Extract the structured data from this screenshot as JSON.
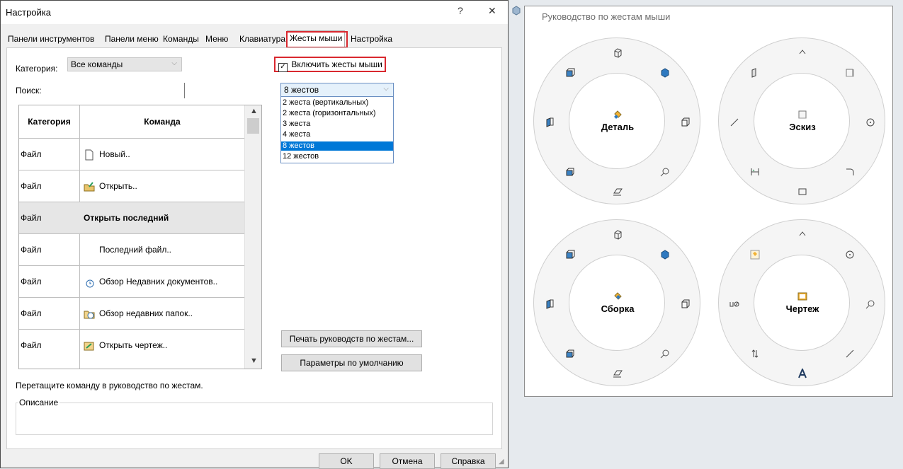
{
  "dialog": {
    "title": "Настройка",
    "help_button": "?",
    "close_button": "✕",
    "tabs": [
      "Панели инструментов",
      "Панели меню",
      "Команды",
      "Меню",
      "Клавиатура",
      "Жесты мыши",
      "Настройка"
    ],
    "active_tab": "Жесты мыши",
    "category_label": "Категория:",
    "category_value": "Все команды",
    "search_label": "Поиск:",
    "search_value": "",
    "enable_gestures_label": "Включить жесты мыши",
    "enable_gestures_checked": true,
    "gestures_combo_value": "8 жестов",
    "gestures_options": [
      "2 жеста (вертикальных)",
      "2 жеста (горизонтальных)",
      "3 жеста",
      "4 жеста",
      "8 жестов",
      "12 жестов"
    ],
    "gestures_selected_index": 4,
    "table": {
      "columns": [
        "Категория",
        "Команда"
      ],
      "rows": [
        {
          "category": "Файл",
          "command": "Новый..",
          "icon": "new-file-icon"
        },
        {
          "category": "Файл",
          "command": "Открыть..",
          "icon": "open-folder-icon"
        },
        {
          "category": "Файл",
          "command": "Открыть последний",
          "icon": "",
          "bold": true
        },
        {
          "category": "Файл",
          "command": "Последний файл..",
          "icon": ""
        },
        {
          "category": "Файл",
          "command": "Обзор Недавних документов..",
          "icon": "recent-documents-icon"
        },
        {
          "category": "Файл",
          "command": "Обзор недавних папок..",
          "icon": "recent-folders-icon"
        },
        {
          "category": "Файл",
          "command": "Открыть чертеж..",
          "icon": "open-drawing-icon"
        }
      ]
    },
    "print_guide_button": "Печать руководств по жестам...",
    "defaults_button": "Параметры по умолчанию",
    "drag_hint": "Перетащите команду в руководство по жестам.",
    "description_label": "Описание",
    "ok_button": "OK",
    "cancel_button": "Отмена",
    "help_bottom_button": "Справка"
  },
  "guide": {
    "title": "Руководство по жестам мыши",
    "circles": [
      {
        "label": "Деталь"
      },
      {
        "label": "Эскиз"
      },
      {
        "label": "Сборка"
      },
      {
        "label": "Чертеж"
      }
    ]
  },
  "colors": {
    "highlight_border": "#d9282f",
    "selected_item": "#0078d7"
  }
}
